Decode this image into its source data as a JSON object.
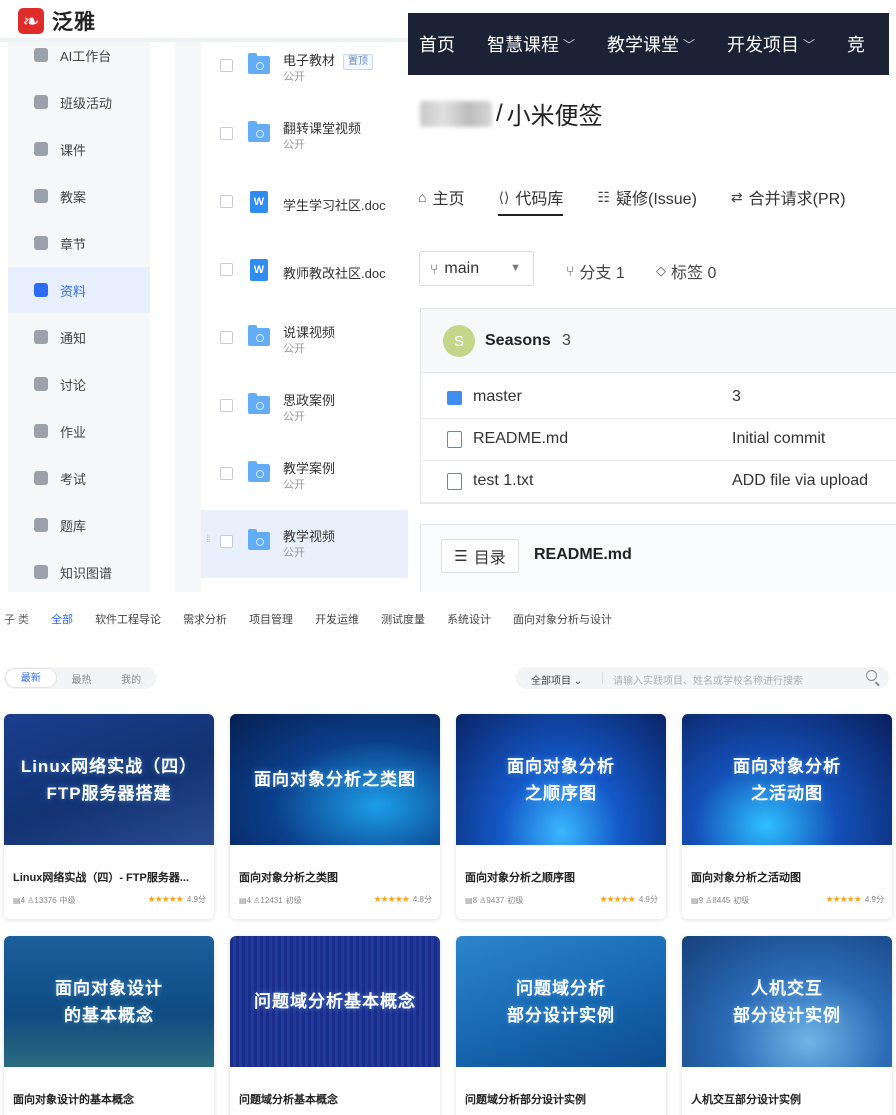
{
  "lms": {
    "brand": "泛雅",
    "sidebar": [
      {
        "label": "AI工作台",
        "icon": "ai-icon"
      },
      {
        "label": "班级活动",
        "icon": "grid-icon"
      },
      {
        "label": "课件",
        "icon": "courseware-icon"
      },
      {
        "label": "教案",
        "icon": "lesson-plan-icon"
      },
      {
        "label": "章节",
        "icon": "chapter-list-icon"
      },
      {
        "label": "资料",
        "icon": "folder-icon",
        "active": true
      },
      {
        "label": "通知",
        "icon": "speaker-icon"
      },
      {
        "label": "讨论",
        "icon": "chat-bubble-icon"
      },
      {
        "label": "作业",
        "icon": "homework-icon"
      },
      {
        "label": "考试",
        "icon": "exam-icon"
      },
      {
        "label": "题库",
        "icon": "question-bank-icon"
      },
      {
        "label": "知识图谱",
        "icon": "knowledge-graph-icon"
      }
    ],
    "files": [
      {
        "name": "电子教材",
        "sub": "公开",
        "type": "folder",
        "badge": "置顶"
      },
      {
        "name": "翻转课堂视频",
        "sub": "公开",
        "type": "folder"
      },
      {
        "name": "学生学习社区.doc",
        "type": "word"
      },
      {
        "name": "教师教改社区.doc",
        "type": "word"
      },
      {
        "name": "说课视频",
        "sub": "公开",
        "type": "folder"
      },
      {
        "name": "思政案例",
        "sub": "公开",
        "type": "folder"
      },
      {
        "name": "教学案例",
        "sub": "公开",
        "type": "folder"
      },
      {
        "name": "教学视频",
        "sub": "公开",
        "type": "folder"
      }
    ]
  },
  "git": {
    "nav": [
      "首页",
      "智慧课程",
      "教学课堂",
      "开发项目",
      "竞"
    ],
    "nav_has_dropdown": [
      false,
      true,
      true,
      true,
      false
    ],
    "repo_sep": "/",
    "repo_name": "小米便签",
    "tabs": [
      {
        "label": "主页",
        "icon": "home-icon"
      },
      {
        "label": "代码库",
        "icon": "code-icon",
        "active": true
      },
      {
        "label": "疑修(Issue)",
        "icon": "issue-icon"
      },
      {
        "label": "合并请求(PR)",
        "icon": "pull-request-icon"
      }
    ],
    "branch": "main",
    "branches_label": "分支 1",
    "tags_label": "标签 0",
    "commit": {
      "avatar": "S",
      "author": "Seasons",
      "count": "3"
    },
    "files": [
      {
        "name": "master",
        "msg": "3",
        "type": "dir"
      },
      {
        "name": "README.md",
        "msg": "Initial commit",
        "type": "file"
      },
      {
        "name": "test 1.txt",
        "msg": "ADD file via upload",
        "type": "file"
      }
    ],
    "toc": "目录",
    "readme": "README.md"
  },
  "market": {
    "category_label": "子 类",
    "categories": [
      "全部",
      "软件工程导论",
      "需求分析",
      "项目管理",
      "开发运维",
      "测试度量",
      "系统设计",
      "面向对象分析与设计"
    ],
    "sort": [
      "最新",
      "最热",
      "我的"
    ],
    "project_filter": "全部项目",
    "search_placeholder": "请输入实践项目、姓名或学校名称进行搜索",
    "cards": [
      {
        "cover": "Linux网络实战（四）\nFTP服务器搭建",
        "title": "Linux网络实战（四）- FTP服务器...",
        "lessons": "4",
        "learners": "13376",
        "level": "中级",
        "score": "4.9分"
      },
      {
        "cover": "面向对象分析之类图",
        "title": "面向对象分析之类图",
        "lessons": "4",
        "learners": "12431",
        "level": "初级",
        "score": "4.8分"
      },
      {
        "cover": "面向对象分析\n之顺序图",
        "title": "面向对象分析之顺序图",
        "lessons": "8",
        "learners": "9437",
        "level": "初级",
        "score": "4.9分"
      },
      {
        "cover": "面向对象分析\n之活动图",
        "title": "面向对象分析之活动图",
        "lessons": "9",
        "learners": "8445",
        "level": "初级",
        "score": "4.9分"
      },
      {
        "cover": "面向对象设计\n的基本概念",
        "title": "面向对象设计的基本概念"
      },
      {
        "cover": "问题域分析基本概念",
        "title": "问题域分析基本概念"
      },
      {
        "cover": "问题域分析\n部分设计实例",
        "title": "问题域分析部分设计实例"
      },
      {
        "cover": "人机交互\n部分设计实例",
        "title": "人机交互部分设计实例"
      }
    ]
  }
}
